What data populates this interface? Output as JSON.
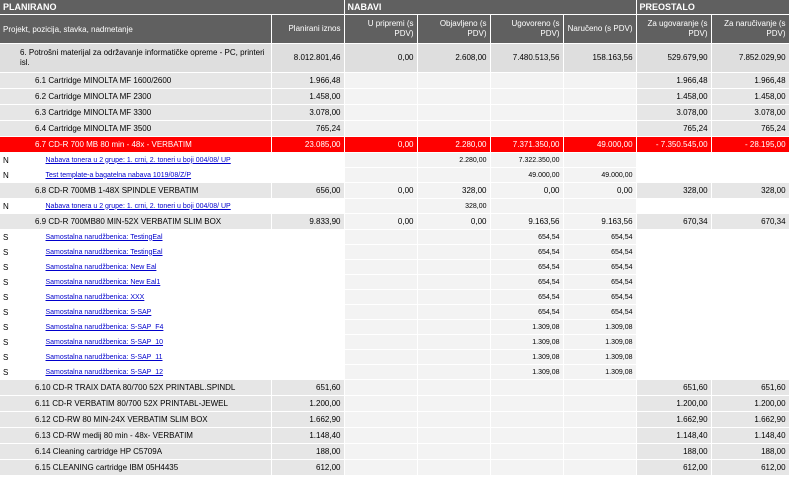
{
  "header": {
    "group_planning": "PLANIRANO",
    "group_purchase": "NABAVI",
    "group_remaining": "PREOSTALO",
    "col_project": "Projekt, pozicija, stavka, nadmetanje",
    "col_planned": "Planirani iznos",
    "col_prepare": "U pripremi (s PDV)",
    "col_published": "Objavljeno (s PDV)",
    "col_contracted": "Ugovoreno (s PDV)",
    "col_ordered": "Naručeno (s PDV)",
    "col_to_contract": "Za ugovaranje (s PDV)",
    "col_to_order": "Za naručivanje (s PDV)"
  },
  "rows": [
    {
      "type": "top",
      "flag": "",
      "name": "6. Potrošni materijal za održavanje informatičke opreme - PC, printeri isl.",
      "planned": "8.012.801,46",
      "prepare": "0,00",
      "published": "2.608,00",
      "contracted": "7.480.513,56",
      "ordered": "158.163,56",
      "to_contract": "529.679,90",
      "to_order": "7.852.029,90"
    },
    {
      "type": "item",
      "flag": "",
      "name": "6.1 Cartridge MINOLTA MF 1600/2600",
      "planned": "1.966,48",
      "prepare": "",
      "published": "",
      "contracted": "",
      "ordered": "",
      "to_contract": "1.966,48",
      "to_order": "1.966,48"
    },
    {
      "type": "item",
      "flag": "",
      "name": "6.2 Cartridge MINOLTA MF 2300",
      "planned": "1.458,00",
      "prepare": "",
      "published": "",
      "contracted": "",
      "ordered": "",
      "to_contract": "1.458,00",
      "to_order": "1.458,00"
    },
    {
      "type": "item",
      "flag": "",
      "name": "6.3 Cartridge MINOLTA MF 3300",
      "planned": "3.078,00",
      "prepare": "",
      "published": "",
      "contracted": "",
      "ordered": "",
      "to_contract": "3.078,00",
      "to_order": "3.078,00"
    },
    {
      "type": "item",
      "flag": "",
      "name": "6.4 Cartridge MINOLTA MF 3500",
      "planned": "765,24",
      "prepare": "",
      "published": "",
      "contracted": "",
      "ordered": "",
      "to_contract": "765,24",
      "to_order": "765,24"
    },
    {
      "type": "sel",
      "flag": "",
      "name": "6.7 CD-R 700 MB 80 min - 48x - VERBATIM",
      "planned": "23.085,00",
      "prepare": "0,00",
      "published": "2.280,00",
      "contracted": "7.371.350,00",
      "ordered": "49.000,00",
      "to_contract": "- 7.350.545,00",
      "to_order": "- 28.195,00"
    },
    {
      "type": "sub",
      "flag": "N",
      "name": "Nabava tonera u 2 grupe: 1. crni, 2. toneri u boji 004/08/ UP",
      "planned": "",
      "prepare": "",
      "published": "2.280,00",
      "contracted": "7.322.350,00",
      "ordered": "",
      "to_contract": "",
      "to_order": ""
    },
    {
      "type": "sub",
      "flag": "N",
      "name": "Test template-a bagatelna nabava 1019/08/Z/P",
      "planned": "",
      "prepare": "",
      "published": "",
      "contracted": "49.000,00",
      "ordered": "49.000,00",
      "to_contract": "",
      "to_order": ""
    },
    {
      "type": "item",
      "flag": "",
      "name": "6.8 CD-R 700MB 1-48X SPINDLE VERBATIM",
      "planned": "656,00",
      "prepare": "0,00",
      "published": "328,00",
      "contracted": "0,00",
      "ordered": "0,00",
      "to_contract": "328,00",
      "to_order": "328,00"
    },
    {
      "type": "sub",
      "flag": "N",
      "name": "Nabava tonera u 2 grupe: 1. crni, 2. toneri u boji 004/08/ UP",
      "planned": "",
      "prepare": "",
      "published": "328,00",
      "contracted": "",
      "ordered": "",
      "to_contract": "",
      "to_order": ""
    },
    {
      "type": "item",
      "flag": "",
      "name": "6.9 CD-R 700MB80 MIN-52X VERBATIM SLIM BOX",
      "planned": "9.833,90",
      "prepare": "0,00",
      "published": "0,00",
      "contracted": "9.163,56",
      "ordered": "9.163,56",
      "to_contract": "670,34",
      "to_order": "670,34"
    },
    {
      "type": "sub",
      "flag": "S",
      "name": "Samostalna narudžbenica: TestingEal",
      "planned": "",
      "prepare": "",
      "published": "",
      "contracted": "654,54",
      "ordered": "654,54",
      "to_contract": "",
      "to_order": ""
    },
    {
      "type": "sub",
      "flag": "S",
      "name": "Samostalna narudžbenica: TestingEal",
      "planned": "",
      "prepare": "",
      "published": "",
      "contracted": "654,54",
      "ordered": "654,54",
      "to_contract": "",
      "to_order": ""
    },
    {
      "type": "sub",
      "flag": "S",
      "name": "Samostalna narudžbenica: New Eal",
      "planned": "",
      "prepare": "",
      "published": "",
      "contracted": "654,54",
      "ordered": "654,54",
      "to_contract": "",
      "to_order": ""
    },
    {
      "type": "sub",
      "flag": "S",
      "name": "Samostalna narudžbenica: New Eal1",
      "planned": "",
      "prepare": "",
      "published": "",
      "contracted": "654,54",
      "ordered": "654,54",
      "to_contract": "",
      "to_order": ""
    },
    {
      "type": "sub",
      "flag": "S",
      "name": "Samostalna narudžbenica: XXX",
      "planned": "",
      "prepare": "",
      "published": "",
      "contracted": "654,54",
      "ordered": "654,54",
      "to_contract": "",
      "to_order": ""
    },
    {
      "type": "sub",
      "flag": "S",
      "name": "Samostalna narudžbenica: S-SAP",
      "planned": "",
      "prepare": "",
      "published": "",
      "contracted": "654,54",
      "ordered": "654,54",
      "to_contract": "",
      "to_order": ""
    },
    {
      "type": "sub",
      "flag": "S",
      "name": "Samostalna narudžbenica: S-SAP_F4",
      "planned": "",
      "prepare": "",
      "published": "",
      "contracted": "1.309,08",
      "ordered": "1.309,08",
      "to_contract": "",
      "to_order": ""
    },
    {
      "type": "sub",
      "flag": "S",
      "name": "Samostalna narudžbenica: S-SAP_10",
      "planned": "",
      "prepare": "",
      "published": "",
      "contracted": "1.309,08",
      "ordered": "1.309,08",
      "to_contract": "",
      "to_order": ""
    },
    {
      "type": "sub",
      "flag": "S",
      "name": "Samostalna narudžbenica: S-SAP_11",
      "planned": "",
      "prepare": "",
      "published": "",
      "contracted": "1.309,08",
      "ordered": "1.309,08",
      "to_contract": "",
      "to_order": ""
    },
    {
      "type": "sub",
      "flag": "S",
      "name": "Samostalna narudžbenica: S-SAP_12",
      "planned": "",
      "prepare": "",
      "published": "",
      "contracted": "1.309,08",
      "ordered": "1.309,08",
      "to_contract": "",
      "to_order": ""
    },
    {
      "type": "item",
      "flag": "",
      "name": "6.10 CD-R TRAIX DATA 80/700 52X PRINTABL.SPINDL",
      "planned": "651,60",
      "prepare": "",
      "published": "",
      "contracted": "",
      "ordered": "",
      "to_contract": "651,60",
      "to_order": "651,60"
    },
    {
      "type": "item",
      "flag": "",
      "name": "6.11 CD-R VERBATIM 80/700 52X PRINTABL-JEWEL",
      "planned": "1.200,00",
      "prepare": "",
      "published": "",
      "contracted": "",
      "ordered": "",
      "to_contract": "1.200,00",
      "to_order": "1.200,00"
    },
    {
      "type": "item",
      "flag": "",
      "name": "6.12 CD-RW 80 MIN-24X VERBATIM SLIM BOX",
      "planned": "1.662,90",
      "prepare": "",
      "published": "",
      "contracted": "",
      "ordered": "",
      "to_contract": "1.662,90",
      "to_order": "1.662,90"
    },
    {
      "type": "item",
      "flag": "",
      "name": "6.13 CD-RW medij 80 min - 48x- VERBATIM",
      "planned": "1.148,40",
      "prepare": "",
      "published": "",
      "contracted": "",
      "ordered": "",
      "to_contract": "1.148,40",
      "to_order": "1.148,40"
    },
    {
      "type": "item",
      "flag": "",
      "name": "6.14 Cleaning cartridge HP C5709A",
      "planned": "188,00",
      "prepare": "",
      "published": "",
      "contracted": "",
      "ordered": "",
      "to_contract": "188,00",
      "to_order": "188,00"
    },
    {
      "type": "item",
      "flag": "",
      "name": "6.15 CLEANING cartridge IBM 05H4435",
      "planned": "612,00",
      "prepare": "",
      "published": "",
      "contracted": "",
      "ordered": "",
      "to_contract": "612,00",
      "to_order": "612,00"
    }
  ]
}
